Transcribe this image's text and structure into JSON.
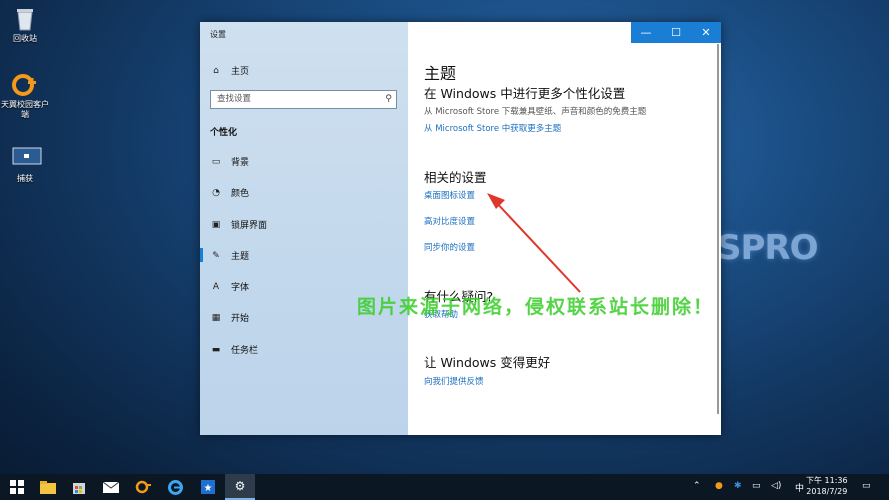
{
  "desktop": {
    "icons": [
      {
        "label": "回收站",
        "icon": "recycle-bin-icon"
      },
      {
        "label": "天翼校园客户端",
        "icon": "tianyi-client-icon"
      },
      {
        "label": "捕获",
        "icon": "capture-image-icon"
      }
    ],
    "wallpaper_logo": "SPRO",
    "watermark": "图片来源于网络，侵权联系站长删除！"
  },
  "window": {
    "title": "设置",
    "controls": {
      "minimize": "—",
      "maximize": "☐",
      "close": "✕"
    },
    "nav": {
      "home": "主页",
      "search_placeholder": "查找设置",
      "section": "个性化",
      "items": [
        {
          "label": "背景",
          "icon": "picture-icon"
        },
        {
          "label": "颜色",
          "icon": "palette-icon"
        },
        {
          "label": "锁屏界面",
          "icon": "lock-screen-icon"
        },
        {
          "label": "主题",
          "icon": "theme-brush-icon",
          "selected": true
        },
        {
          "label": "字体",
          "icon": "font-icon"
        },
        {
          "label": "开始",
          "icon": "start-icon"
        },
        {
          "label": "任务栏",
          "icon": "taskbar-icon"
        }
      ]
    },
    "content": {
      "title": "主题",
      "store_heading": "在 Windows 中进行更多个性化设置",
      "store_desc": "从 Microsoft Store 下载兼具壁纸、声音和颜色的免费主题",
      "store_link": "从 Microsoft Store 中获取更多主题",
      "related_heading": "相关的设置",
      "related_links": [
        "桌面图标设置",
        "高对比度设置",
        "同步你的设置"
      ],
      "help_heading": "有什么疑问?",
      "help_link": "获取帮助",
      "better_heading": "让 Windows 变得更好",
      "feedback_link": "向我们提供反馈"
    }
  },
  "annotation": {
    "arrow_color": "#e0362b"
  },
  "taskbar": {
    "apps": [
      "start-icon",
      "file-explorer-icon",
      "store-icon",
      "mail-icon",
      "tianyi-icon",
      "edge-icon",
      "pinned-app-icon",
      "settings-icon"
    ],
    "tray_lang": "中",
    "clock_time": "下午 11:36",
    "clock_date": "2018/7/29"
  }
}
